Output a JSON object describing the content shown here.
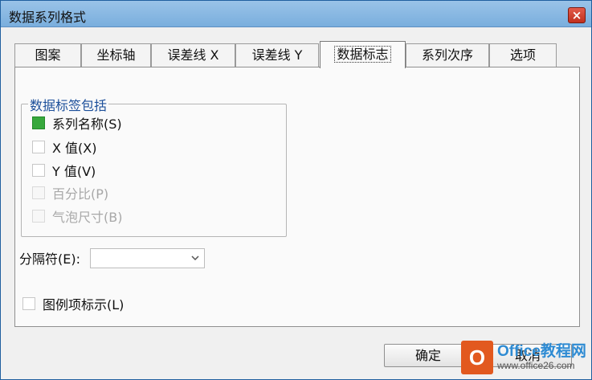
{
  "window": {
    "title": "数据系列格式",
    "close_label": "×"
  },
  "tabs": [
    {
      "label": "图案"
    },
    {
      "label": "坐标轴"
    },
    {
      "label": "误差线 X"
    },
    {
      "label": "误差线 Y"
    },
    {
      "label": "数据标志",
      "active": true
    },
    {
      "label": "系列次序"
    },
    {
      "label": "选项"
    }
  ],
  "group": {
    "legend": "数据标签包括",
    "options": [
      {
        "label": "系列名称(S)",
        "checked": true,
        "enabled": true
      },
      {
        "label": "X 值(X)",
        "checked": false,
        "enabled": true
      },
      {
        "label": "Y 值(V)",
        "checked": false,
        "enabled": true
      },
      {
        "label": "百分比(P)",
        "checked": false,
        "enabled": false
      },
      {
        "label": "气泡尺寸(B)",
        "checked": false,
        "enabled": false
      }
    ]
  },
  "separator": {
    "label": "分隔符(E):",
    "value": ""
  },
  "legend_key": {
    "label": "图例项标示(L)",
    "checked": false
  },
  "buttons": {
    "ok": "确定",
    "cancel": "取消"
  },
  "watermark": {
    "logo": "O",
    "brand": "Office教程网",
    "url": "www.office26.com"
  },
  "colors": {
    "titlebar": "#8bbbe4",
    "checked": "#37a83c",
    "group_legend": "#1c4f9a"
  }
}
